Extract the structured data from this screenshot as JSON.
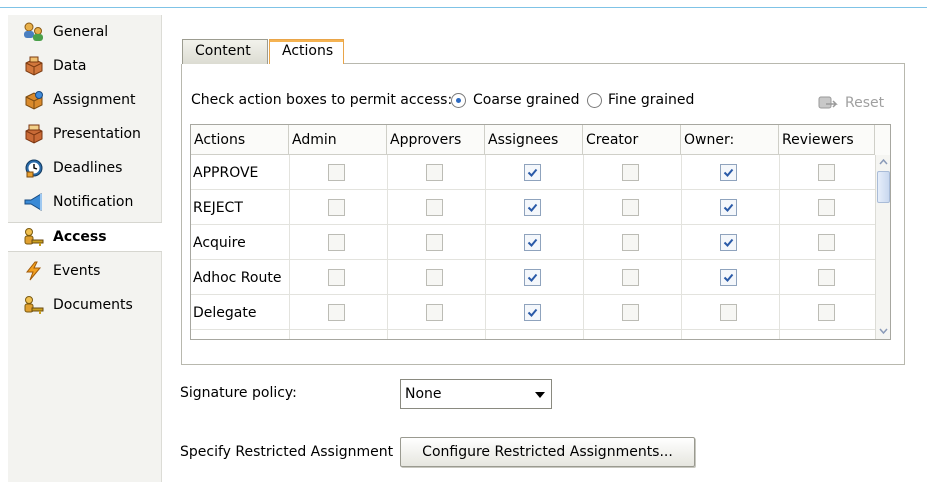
{
  "sidebar": {
    "items": [
      {
        "label": "General",
        "icon": "users-gear-icon",
        "active": false
      },
      {
        "label": "Data",
        "icon": "data-cubes-icon",
        "active": false
      },
      {
        "label": "Assignment",
        "icon": "assignment-cubes-icon",
        "active": false
      },
      {
        "label": "Presentation",
        "icon": "presentation-cubes-icon",
        "active": false
      },
      {
        "label": "Deadlines",
        "icon": "clock-icon",
        "active": false
      },
      {
        "label": "Notification",
        "icon": "megaphone-icon",
        "active": false
      },
      {
        "label": "Access",
        "icon": "key-user-icon",
        "active": true
      },
      {
        "label": "Events",
        "icon": "lightning-icon",
        "active": false
      },
      {
        "label": "Documents",
        "icon": "key-user-icon",
        "active": false
      }
    ]
  },
  "tabs": [
    {
      "label": "Content",
      "selected": false
    },
    {
      "label": "Actions",
      "selected": true
    }
  ],
  "access": {
    "prompt": "Check action boxes to permit access:",
    "coarse_label": "Coarse grained",
    "fine_label": "Fine grained",
    "selected_mode": "coarse",
    "reset_label": "Reset"
  },
  "table": {
    "columns": [
      "Actions",
      "Admin",
      "Approvers",
      "Assignees",
      "Creator",
      "Owner:",
      "Reviewers"
    ],
    "rows": [
      {
        "name": "APPROVE",
        "checks": [
          false,
          false,
          true,
          false,
          true,
          false
        ]
      },
      {
        "name": "REJECT",
        "checks": [
          false,
          false,
          true,
          false,
          true,
          false
        ]
      },
      {
        "name": "Acquire",
        "checks": [
          false,
          false,
          true,
          false,
          true,
          false
        ]
      },
      {
        "name": "Adhoc Route",
        "checks": [
          false,
          false,
          true,
          false,
          true,
          false
        ]
      },
      {
        "name": "Delegate",
        "checks": [
          false,
          false,
          true,
          false,
          false,
          false
        ]
      }
    ]
  },
  "form": {
    "signature_label": "Signature policy:",
    "signature_value": "None",
    "restricted_label": "Specify Restricted Assignment",
    "restricted_button": "Configure Restricted Assignments..."
  },
  "colors": {
    "accent_blue": "#2c6ac2",
    "tab_highlight": "#f5b352",
    "check_blue": "#2a5aa8"
  }
}
